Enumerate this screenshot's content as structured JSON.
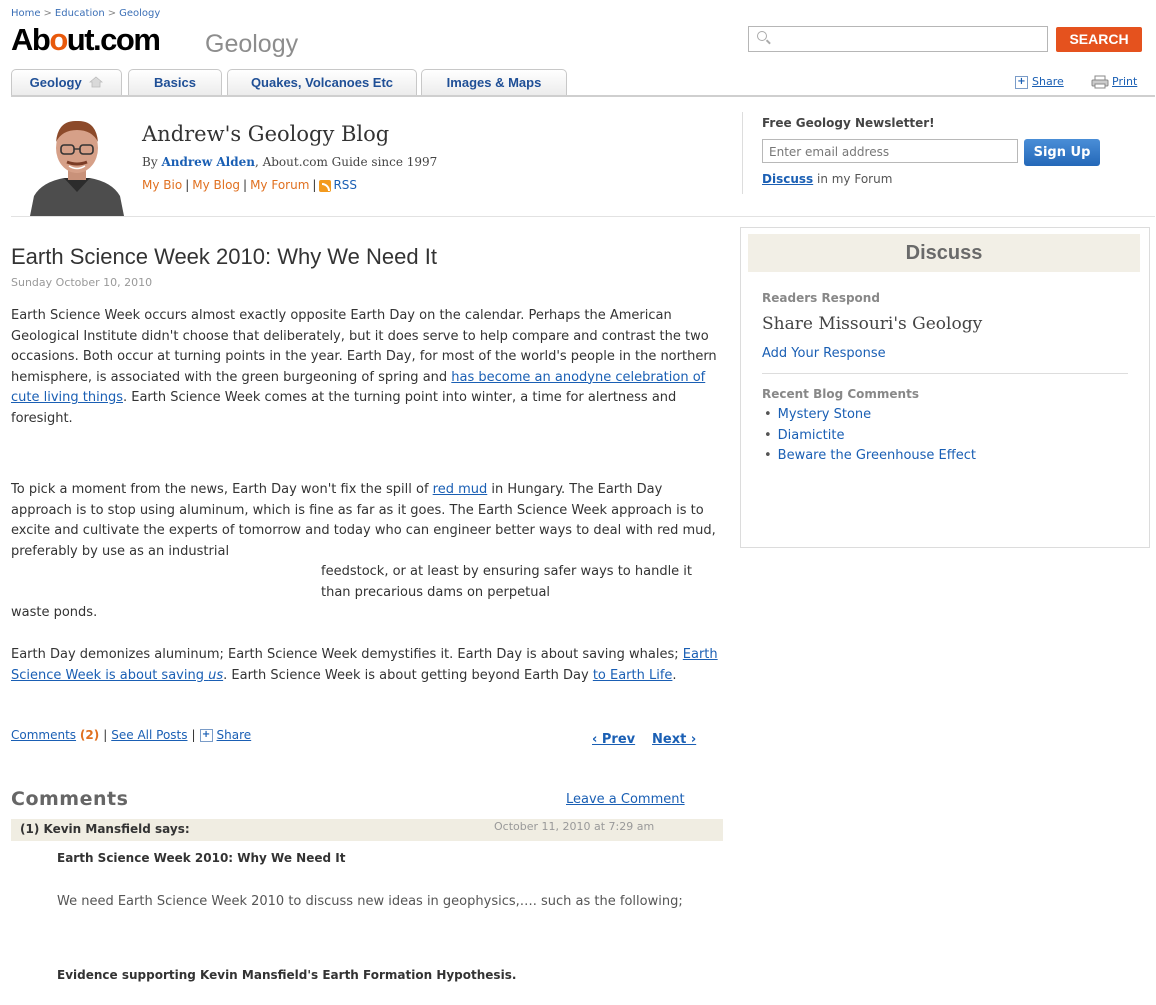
{
  "breadcrumb": [
    "Home",
    "Education",
    "Geology"
  ],
  "header": {
    "logo_pre": "Ab",
    "logo_o": "o",
    "logo_post": "ut.com",
    "channel": "Geology",
    "search_placeholder": "",
    "search_button": "SEARCH",
    "share": "Share",
    "print": "Print"
  },
  "tabs": [
    "Geology",
    "Basics",
    "Quakes, Volcanoes Etc",
    "Images & Maps"
  ],
  "blog": {
    "title": "Andrew's Geology Blog",
    "by": "By",
    "author": "Andrew Alden",
    "since": ", About.com Guide since 1997",
    "links": [
      "My Bio",
      "My Blog",
      "My Forum",
      "RSS"
    ]
  },
  "newsletter": {
    "title": "Free Geology Newsletter!",
    "placeholder": "Enter email address",
    "button": "Sign Up",
    "discuss": "Discuss",
    "discuss_rest": " in my Forum"
  },
  "post": {
    "title": "Earth Science Week 2010: Why We Need It",
    "date": "Sunday October 10, 2010",
    "p1_a": "Earth Science Week occurs almost exactly opposite Earth Day on the calendar. Perhaps the American Geological Institute didn't choose that deliberately, but it does serve to help compare and contrast the two occasions. Both occur at turning points in the year. Earth Day, for most of the world's people in the northern hemisphere, is associated with the green burgeoning of spring and ",
    "p1_link": "has become an anodyne celebration of cute living things",
    "p1_b": ". Earth Science Week comes at the turning point into winter, a time for alertness and foresight.",
    "p2_a": "To pick a moment from the news, Earth Day won't fix the spill of ",
    "p2_link": "red mud",
    "p2_b": " in Hungary. The Earth Day approach is to stop using aluminum, which is fine as far as it goes. The Earth Science Week approach is to excite and cultivate the experts of tomorrow and today who can engineer better ways to deal with red mud, preferably by use as an industrial",
    "p2_c": "feedstock, or at least by ensuring safer ways to handle it than precarious dams on perpetual",
    "p2_d": "waste ponds.",
    "p3_a": "Earth Day demonizes aluminum; Earth Science Week demystifies it. Earth Day is about saving whales; ",
    "p3_link": "Earth Science Week is about saving ",
    "p3_link_em": "us",
    "p3_b": ". Earth Science Week is about getting beyond Earth Day ",
    "p3_link2": "to Earth Life",
    "p3_c": ".",
    "comments_label": "Comments",
    "comments_count": "(2)",
    "see_all": "See All Posts",
    "share": "Share",
    "prev": "‹ Prev",
    "next": "Next ›"
  },
  "comments": {
    "heading": "Comments",
    "leave": "Leave a Comment",
    "items": [
      {
        "who": "(1) Kevin Mansfield says:",
        "date": "October 11, 2010 at 7:29 am",
        "title": "Earth Science Week 2010: Why We Need It",
        "body": "We need Earth Science Week 2010 to discuss new ideas in geophysics,…. such as the following;",
        "evidence": "Evidence supporting Kevin Mansfield's Earth Formation Hypothesis."
      }
    ]
  },
  "sidebar": {
    "heading": "Discuss",
    "readers_label": "Readers Respond",
    "readers_title": "Share Missouri's Geology",
    "add_response": "Add Your Response",
    "recent_label": "Recent Blog Comments",
    "recent": [
      "Mystery Stone",
      "Diamictite",
      "Beware the Greenhouse Effect"
    ]
  },
  "colors": {
    "accent": "#e5521e",
    "link": "#1a5fb4",
    "orange_link": "#e07020",
    "tab_text": "#1f4f96"
  }
}
